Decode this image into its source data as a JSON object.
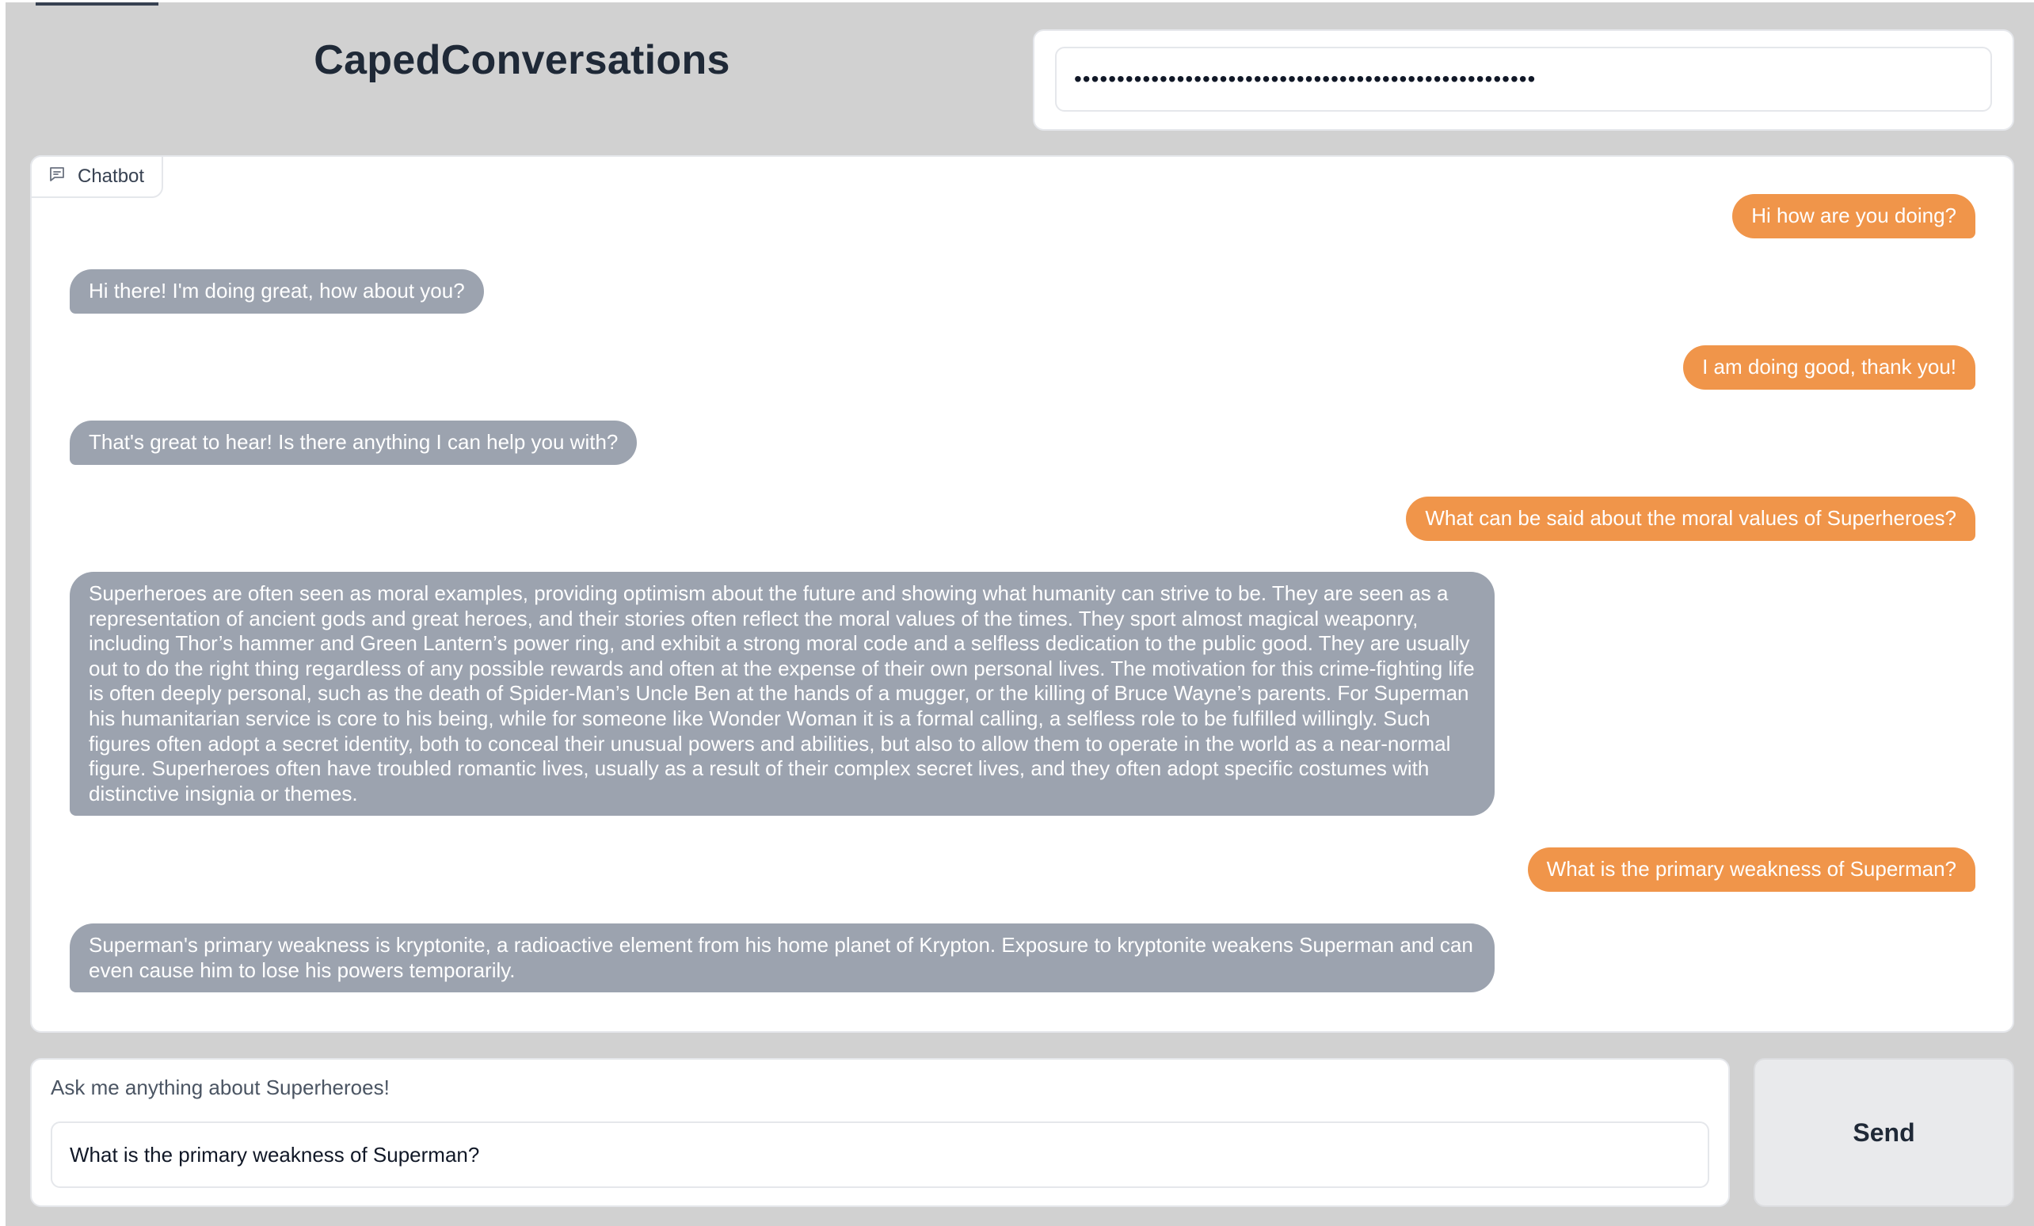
{
  "header": {
    "title": "CapedConversations"
  },
  "api_key": {
    "masked_value": "••••••••••••••••••••••••••••••••••••••••••••••••••••••"
  },
  "chatbot": {
    "label": "Chatbot",
    "messages": [
      {
        "role": "user",
        "text": "Hi how are you doing?"
      },
      {
        "role": "bot",
        "text": "Hi there! I'm doing great, how about you?"
      },
      {
        "role": "user",
        "text": "I am doing good, thank you!"
      },
      {
        "role": "bot",
        "text": "That's great to hear! Is there anything I can help you with?"
      },
      {
        "role": "user",
        "text": "What can be said about the moral values of Superheroes?"
      },
      {
        "role": "bot",
        "text": "Superheroes are often seen as moral examples, providing optimism about the future and showing what humanity can strive to be. They are seen as a representation of ancient gods and great heroes, and their stories often reflect the moral values of the times. They sport almost magical weaponry, including Thor’s hammer and Green Lantern’s power ring, and exhibit a strong moral code and a selfless dedication to the public good. They are usually out to do the right thing regardless of any possible rewards and often at the expense of their own personal lives. The motivation for this crime-fighting life is often deeply personal, such as the death of Spider-Man’s Uncle Ben at the hands of a mugger, or the killing of Bruce Wayne’s parents. For Superman his humanitarian service is core to his being, while for someone like Wonder Woman it is a formal calling, a selfless role to be fulfilled willingly. Such figures often adopt a secret identity, both to conceal their unusual powers and abilities, but also to allow them to operate in the world as a near-normal figure. Superheroes often have troubled romantic lives, usually as a result of their complex secret lives, and they often adopt specific costumes with distinctive insignia or themes."
      },
      {
        "role": "user",
        "text": "What is the primary weakness of Superman?"
      },
      {
        "role": "bot",
        "text": "Superman's primary weakness is kryptonite, a radioactive element from his home planet of Krypton. Exposure to kryptonite weakens Superman and can even cause him to lose his powers temporarily."
      }
    ]
  },
  "query": {
    "label": "Ask me anything about Superheroes!",
    "value": "What is the primary weakness of Superman?"
  },
  "send": {
    "label": "Send"
  },
  "colors": {
    "user_bubble": "#f0954a",
    "bot_bubble": "#9ca3af",
    "background": "#d1d1d1"
  },
  "icons": {
    "chatbot_label_icon": "chat-bubble-icon"
  }
}
